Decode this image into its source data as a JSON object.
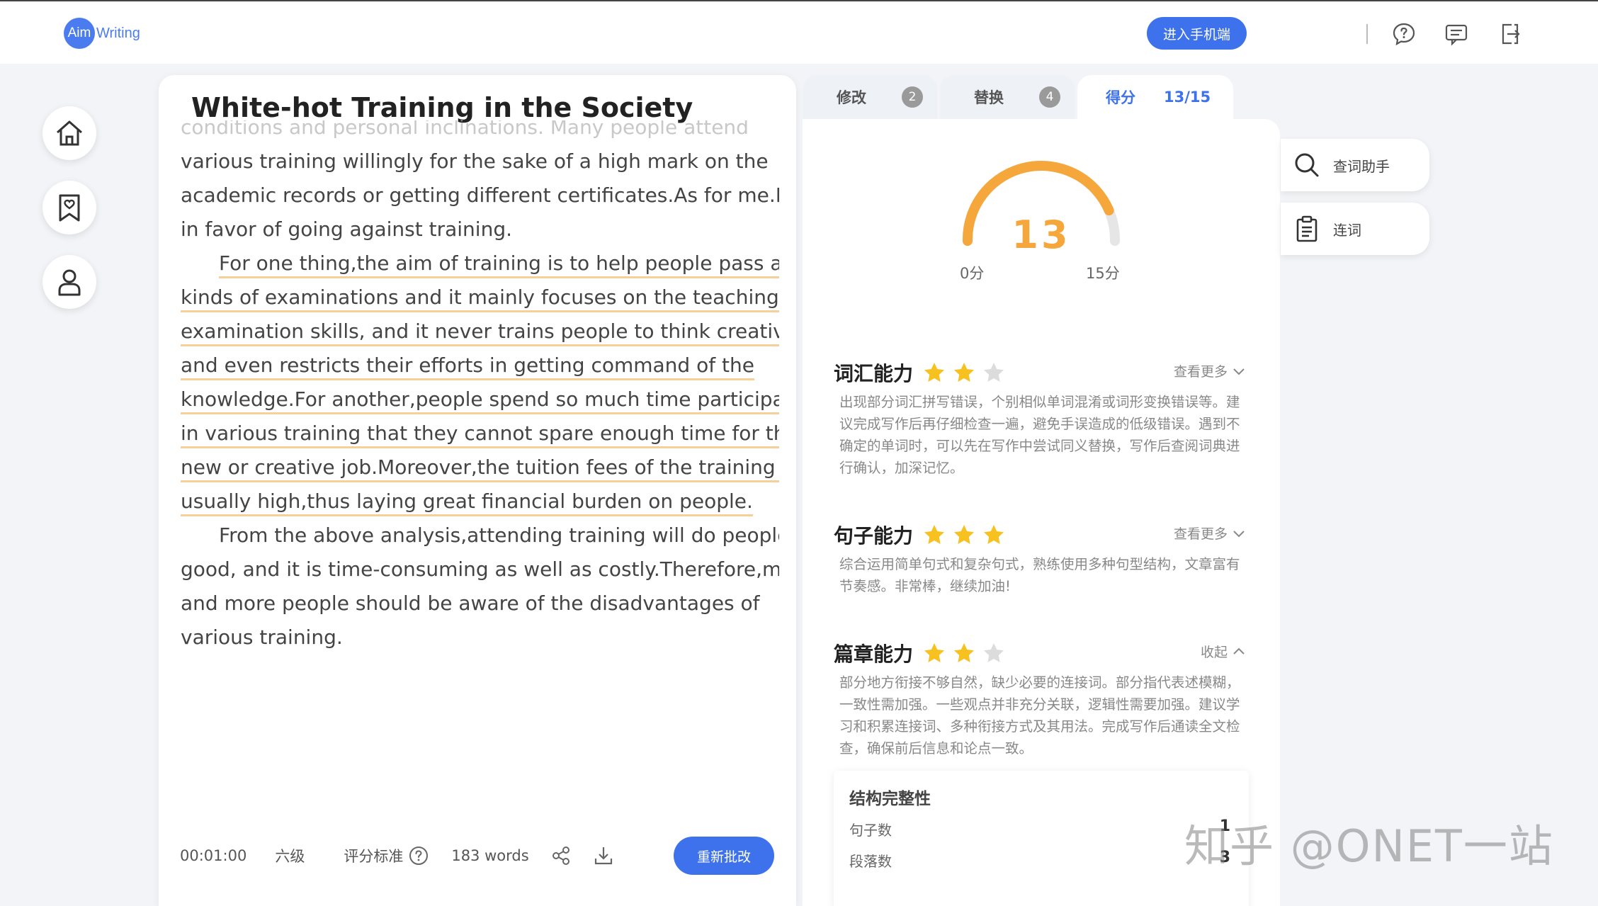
{
  "topbar": {
    "logo_aim": "Aim",
    "logo_writing": "Writing",
    "mobile_button": "进入手机端"
  },
  "essay": {
    "title": "White-hot Training in the Society",
    "lines": [
      {
        "text": "conditions and personal inclinations. Many people attend",
        "style": "faded"
      },
      {
        "text": "various training willingly for the sake of a high mark on the",
        "style": "plain"
      },
      {
        "text": "academic records or getting different certificates.As for me.I am",
        "style": "plain"
      },
      {
        "text": "in favor of going against training.",
        "style": "plain"
      },
      {
        "text": "For one thing,the aim of training is to help people pass all",
        "style": "ul-indent"
      },
      {
        "text": "kinds of examinations and it mainly focuses on the teaching of",
        "style": "ul"
      },
      {
        "text": "examination skills, and it never trains people to think creatively",
        "style": "ul"
      },
      {
        "text": "and even restricts their efforts in getting command of the",
        "style": "ul"
      },
      {
        "text": "knowledge.For another,people spend so much time participating",
        "style": "ul"
      },
      {
        "text": "in various training that they cannot spare enough time for the",
        "style": "ul"
      },
      {
        "text": "new or creative job.Moreover,the tuition fees of the training are",
        "style": "ul"
      },
      {
        "text": "usually high,thus laying great financial burden on people.",
        "style": "ul"
      },
      {
        "text": "From the above analysis,attending training will do people no",
        "style": "indent"
      },
      {
        "text": "good, and it is time-consuming as well as costly.Therefore,more",
        "style": "plain"
      },
      {
        "text": "and more people should be aware of the disadvantages of",
        "style": "plain"
      },
      {
        "text": "various training.",
        "style": "plain"
      }
    ]
  },
  "footer": {
    "time": "00:01:00",
    "level": "六级",
    "criteria": "评分标准",
    "word_count": "183 words",
    "recheck_button": "重新批改"
  },
  "tabs": {
    "revise_label": "修改",
    "revise_count": "2",
    "replace_label": "替换",
    "replace_count": "4",
    "score_label": "得分",
    "score_value": "13/15"
  },
  "score": {
    "value": "13",
    "min_label": "0分",
    "max_label": "15分",
    "fraction": 0.8667,
    "gauge_color": "#f6a73b"
  },
  "sections": {
    "vocab": {
      "title": "词汇能力",
      "stars": 2,
      "toggle": "查看更多",
      "desc": "出现部分词汇拼写错误，个别相似单词混淆或词形变换错误等。建议完成写作后再仔细检查一遍，避免手误造成的低级错误。遇到不确定的单词时，可以先在写作中尝试同义替换，写作后查阅词典进行确认，加深记忆。"
    },
    "sentence": {
      "title": "句子能力",
      "stars": 3,
      "toggle": "查看更多",
      "desc": "综合运用简单句式和复杂句式，熟练使用多种句型结构，文章富有节奏感。非常棒，继续加油!"
    },
    "discourse": {
      "title": "篇章能力",
      "stars": 2,
      "toggle": "收起",
      "desc": "部分地方衔接不够自然，缺少必要的连接词。部分指代表述模糊，一致性需加强。一些观点并非充分关联，逻辑性需要加强。建议学习和积累连接词、多种衔接方式及其用法。完成写作后通读全文检查，确保前后信息和论点一致。"
    }
  },
  "structure": {
    "title": "结构完整性",
    "sentence_label": "句子数",
    "sentence_value": "1",
    "paragraph_label": "段落数",
    "paragraph_value": "3"
  },
  "tools": {
    "lookup": "查词助手",
    "connectives": "连词"
  },
  "watermark": "知乎 @ONET一站",
  "colors": {
    "accent": "#3e72ed",
    "star_on": "#f7c21f",
    "star_off": "#dcdcdc",
    "underline": "#f6cf9b"
  }
}
